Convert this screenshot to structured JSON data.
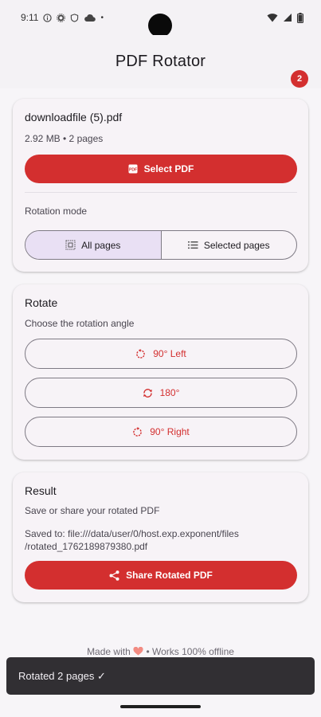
{
  "status_bar": {
    "time": "9:11",
    "dot": "•",
    "icons": [
      "info-icon",
      "gear-icon",
      "shield-icon",
      "cloud-icon",
      "wifi-icon",
      "signal-icon",
      "battery-icon"
    ]
  },
  "header": {
    "title": "PDF Rotator",
    "badge_count": "2"
  },
  "file_card": {
    "file_name": "downloadfile (5).pdf",
    "file_meta": "2.92 MB • 2 pages",
    "select_button": "Select PDF",
    "select_icon_text": "PDF",
    "rotation_mode_label": "Rotation mode",
    "segments": [
      {
        "label": "All pages",
        "active": true
      },
      {
        "label": "Selected pages",
        "active": false
      }
    ]
  },
  "rotate_card": {
    "title": "Rotate",
    "subtitle": "Choose the rotation angle",
    "buttons": [
      {
        "label": "90° Left"
      },
      {
        "label": "180°"
      },
      {
        "label": "90° Right"
      }
    ]
  },
  "result_card": {
    "title": "Result",
    "subtitle": "Save or share your rotated PDF",
    "saved_path_line1": "Saved to: file:///data/user/0/host.exp.exponent/files",
    "saved_path_line2": "/rotated_1762189879380.pdf",
    "share_button": "Share Rotated PDF"
  },
  "footer": {
    "made_with": "Made with",
    "offline": "• Works 100% offline"
  },
  "snackbar": {
    "message": "Rotated 2 pages ✓"
  },
  "colors": {
    "accent": "#d32f2f",
    "segment_active": "#e9e0f4",
    "snackbar": "#312f33"
  }
}
